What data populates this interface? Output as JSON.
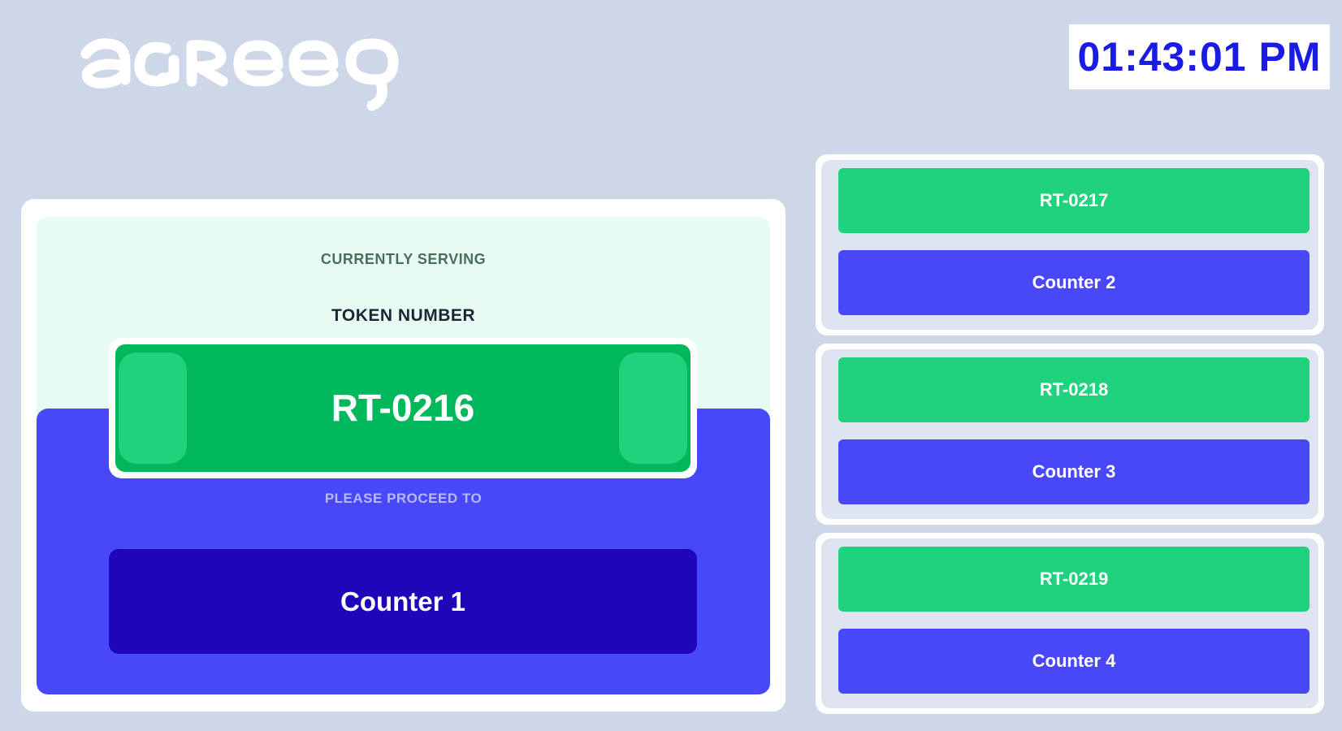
{
  "header": {
    "logo_text": "agreeq",
    "clock": "01:43:01 PM"
  },
  "current": {
    "serving_label": "CURRENTLY SERVING",
    "token_label": "TOKEN NUMBER",
    "token": "RT-0216",
    "proceed_label": "PLEASE PROCEED TO",
    "counter": "Counter 1"
  },
  "queue": [
    {
      "token": "RT-0217",
      "counter": "Counter 2"
    },
    {
      "token": "RT-0218",
      "counter": "Counter 3"
    },
    {
      "token": "RT-0219",
      "counter": "Counter 4"
    }
  ],
  "colors": {
    "background": "#cdd7e8",
    "green": "#00b85c",
    "light_green": "#1fd37e",
    "blue": "#4848f8",
    "dark_blue": "#1e07b9",
    "clock_text": "#1b1be6"
  }
}
